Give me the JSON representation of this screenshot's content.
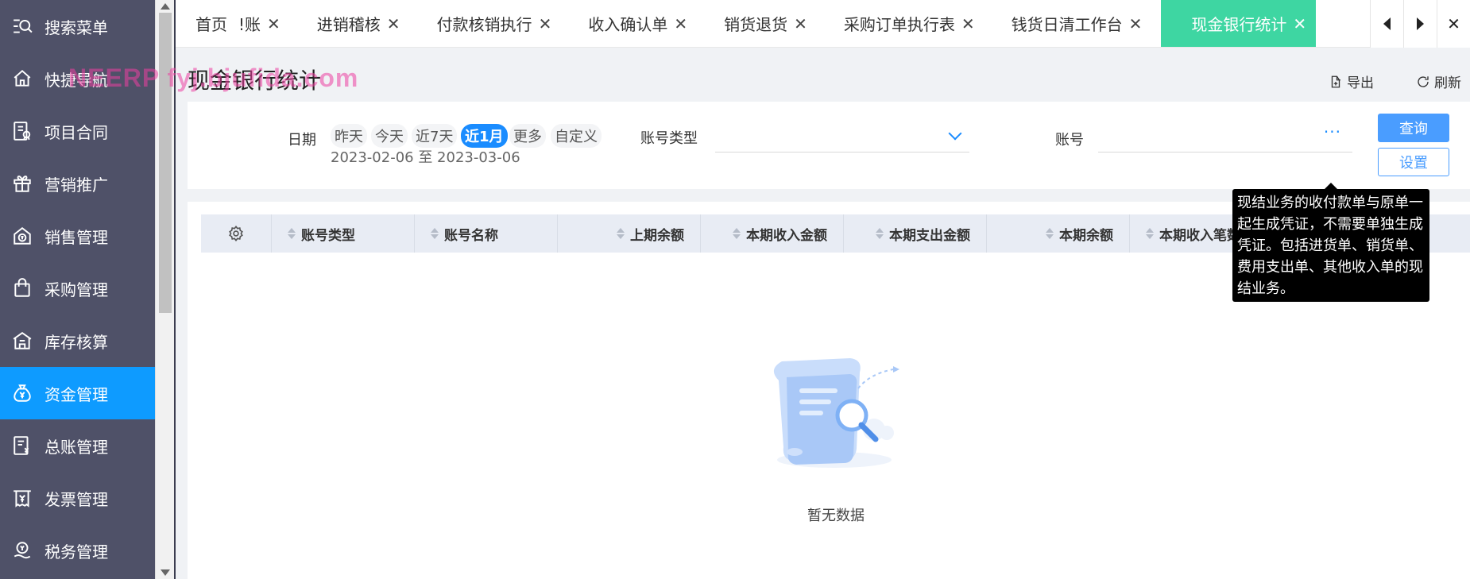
{
  "sidebar": {
    "items": [
      {
        "label": "搜索菜单",
        "icon": "search-menu-icon"
      },
      {
        "label": "快捷导航",
        "icon": "home-icon"
      },
      {
        "label": "项目合同",
        "icon": "contract-icon"
      },
      {
        "label": "营销推广",
        "icon": "gift-icon"
      },
      {
        "label": "销售管理",
        "icon": "sales-icon"
      },
      {
        "label": "采购管理",
        "icon": "shopping-bag-icon"
      },
      {
        "label": "库存核算",
        "icon": "warehouse-icon"
      },
      {
        "label": "资金管理",
        "icon": "money-bag-icon",
        "active": true
      },
      {
        "label": "总账管理",
        "icon": "ledger-icon"
      },
      {
        "label": "发票管理",
        "icon": "invoice-icon"
      },
      {
        "label": "税务管理",
        "icon": "tax-icon"
      }
    ]
  },
  "tabs": [
    {
      "label": "首页"
    },
    {
      "label": "!账"
    },
    {
      "label": "进销稽核"
    },
    {
      "label": "付款核销执行"
    },
    {
      "label": "收入确认单"
    },
    {
      "label": "销货退货"
    },
    {
      "label": "采购订单执行表"
    },
    {
      "label": "钱货日清工作台"
    },
    {
      "label": "现金银行统计",
      "active": true
    }
  ],
  "tab_close_symbol": "✕",
  "watermark": "NEERP  fyj.bjufida.com",
  "page": {
    "title": "现金银行统计",
    "export_label": "导出",
    "refresh_label": "刷新"
  },
  "filter": {
    "date_label": "日期",
    "date_options": [
      "昨天",
      "今天",
      "近7天",
      "近1月",
      "更多",
      "自定义"
    ],
    "date_selected": "近1月",
    "date_range": "2023-02-06 至 2023-03-06",
    "account_type_label": "账号类型",
    "account_type_value": "",
    "account_label": "账号",
    "account_value": "",
    "account_more": "···",
    "query_label": "查询",
    "settings_label": "设置"
  },
  "table": {
    "columns": [
      "账号类型",
      "账号名称",
      "上期余额",
      "本期收入金额",
      "本期支出金额",
      "本期余额",
      "本期收入笔数"
    ],
    "rows": [],
    "empty_text": "暂无数据"
  },
  "tooltip": {
    "text": "现结业务的收付款单与原单一起生成凭证，不需要单独生成凭证。包括进货单、销货单、费用支出单、其他收入单的现结业务。"
  },
  "colors": {
    "sidebar_bg": "#4f5168",
    "sidebar_active": "#0e9bff",
    "tab_active": "#3ed6a2",
    "primary": "#4a9dff",
    "watermark": "#ec40a0"
  }
}
